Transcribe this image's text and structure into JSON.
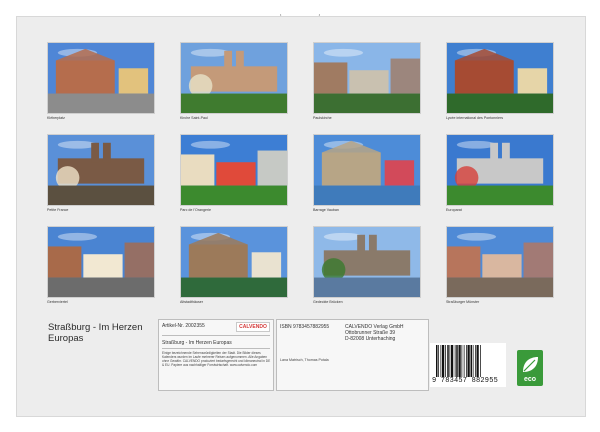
{
  "photos": [
    {
      "caption": "Kléberplatz",
      "palette": {
        "sky": "#4f86d6",
        "main": "#b56d4d",
        "ground": "#8c8c8c",
        "accent": "#e2c27d"
      }
    },
    {
      "caption": "Kirche Saint-Paul",
      "palette": {
        "sky": "#6fa1dd",
        "main": "#c49a79",
        "ground": "#3f7b2f",
        "accent": "#e8e2c8"
      }
    },
    {
      "caption": "Paulskirche",
      "palette": {
        "sky": "#8ab6e8",
        "main": "#a07b62",
        "ground": "#3c6f32",
        "accent": "#c9c1b0"
      }
    },
    {
      "caption": "Lycée international des Pontonniers",
      "palette": {
        "sky": "#3f7fd0",
        "main": "#a64b33",
        "ground": "#2f6a2b",
        "accent": "#e6d5a8"
      }
    },
    {
      "caption": "Petite France",
      "palette": {
        "sky": "#5a90d8",
        "main": "#7a5a45",
        "ground": "#5b5040",
        "accent": "#f0e2c8"
      }
    },
    {
      "caption": "Parc de l’Orangerie",
      "palette": {
        "sky": "#3d7ed4",
        "main": "#e9dcc0",
        "ground": "#3c8a2e",
        "accent": "#e04a3a"
      }
    },
    {
      "caption": "Barrage Vauban",
      "palette": {
        "sky": "#4d8cd8",
        "main": "#b7a586",
        "ground": "#3f7bbb",
        "accent": "#d24a5a"
      }
    },
    {
      "caption": "Europarat",
      "palette": {
        "sky": "#3a79cf",
        "main": "#c8c8c8",
        "ground": "#3c8a2e",
        "accent": "#d6403a"
      }
    },
    {
      "caption": "Gerberviertel",
      "palette": {
        "sky": "#4a84d2",
        "main": "#a86a4a",
        "ground": "#6c6c6c",
        "accent": "#f2e8d2"
      }
    },
    {
      "caption": "Altstadthäuser",
      "palette": {
        "sky": "#5a93dc",
        "main": "#9c7a5a",
        "ground": "#2f6a3b",
        "accent": "#e9e2d0"
      }
    },
    {
      "caption": "Gedeckte Brücken",
      "palette": {
        "sky": "#8fb9e8",
        "main": "#8a7a6a",
        "ground": "#5a7aa0",
        "accent": "#3a7a2e"
      }
    },
    {
      "caption": "Straßburger Münster",
      "palette": {
        "sky": "#4f8ad6",
        "main": "#b7755c",
        "ground": "#7a6a5c",
        "accent": "#d9b7a0"
      }
    }
  ],
  "cover": {
    "title_line1": "Straßburg - Im Herzen",
    "title_line2": "Europas"
  },
  "info": {
    "article_no": "Artikel-Nr. 2002355",
    "brand": "CALVENDO",
    "subtitle": "Straßburg - Im Herzen Europas",
    "fine_print": "Einige bezeichnende Sehenswürdigkeiten der Stadt. Die Bilder dieses Kalenders wurden im Laufe mehrerer Reisen aufgenommen. Alle Angaben ohne Gewähr. CALVENDO produziert bedarfsgerecht und klimaneutral in DE & EU. Papiere aus nachhaltiger Forstwirtschaft. www.calvendo.com"
  },
  "info2": {
    "isbn": "ISBN 9783457882955",
    "publisher_name": "CALVENDO Verlag GmbH",
    "publisher_street": "Ottobrunner Straße 39",
    "publisher_city": "D-82008 Unterhaching",
    "photographers": "Lana Matrisch, Thomas Potala"
  },
  "barcode": {
    "number": "9 783457 882955"
  },
  "eco": {
    "label": "eco",
    "color": "#3a9a3a"
  }
}
